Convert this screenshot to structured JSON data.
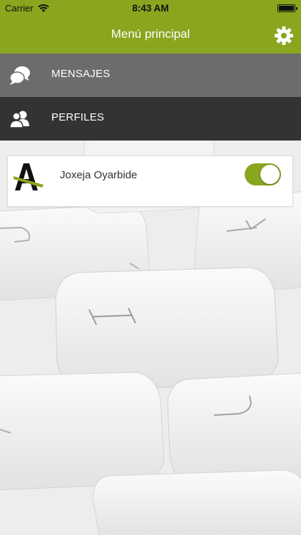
{
  "status_bar": {
    "carrier": "Carrier",
    "time": "8:43 AM",
    "wifi_icon": "wifi-icon",
    "battery_icon": "battery-icon"
  },
  "nav": {
    "title": "Menú principal",
    "settings_icon": "gear-icon"
  },
  "menu": {
    "items": [
      {
        "label": "MENSAJES",
        "icon": "chat-bubbles-icon"
      },
      {
        "label": "PERFILES",
        "icon": "users-icon"
      }
    ]
  },
  "profiles": [
    {
      "name": "Joxeja Oyarbide",
      "logo": "brand-logo-icon",
      "enabled": true
    }
  ],
  "colors": {
    "accent": "#8aa51e",
    "menu_light": "#6c6c6c",
    "menu_dark": "#333333",
    "background": "#eeeeee"
  }
}
